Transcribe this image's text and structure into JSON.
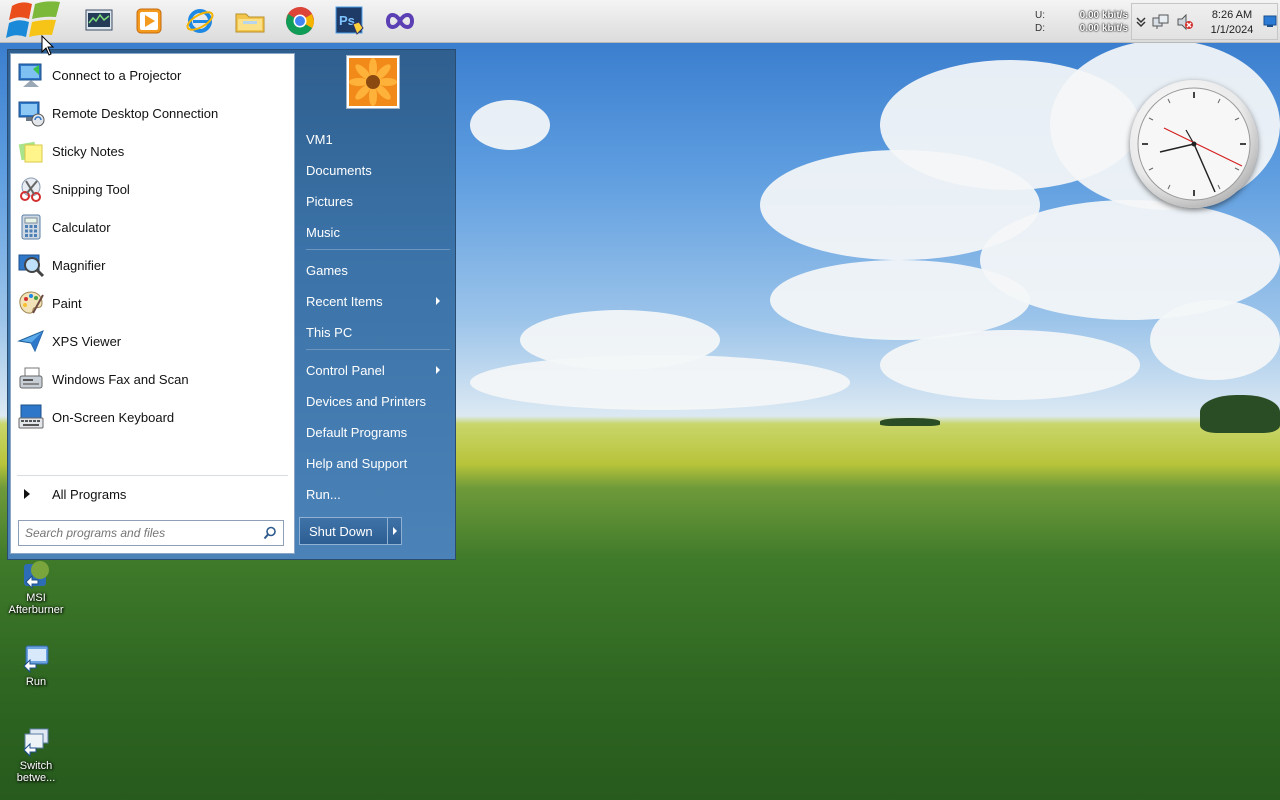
{
  "taskbar": {
    "start_button": "start-orb",
    "pinned": [
      {
        "name": "task-manager-icon"
      },
      {
        "name": "media-player-icon"
      },
      {
        "name": "internet-explorer-icon"
      },
      {
        "name": "file-explorer-icon"
      },
      {
        "name": "chrome-icon"
      },
      {
        "name": "photoshop-icon"
      },
      {
        "name": "visual-studio-icon"
      }
    ],
    "net_meter": {
      "up_label": "U:",
      "up_value": "0.00 kbit/s",
      "down_label": "D:",
      "down_value": "0.00 kbit/s"
    },
    "clock": {
      "time": "8:26 AM",
      "date": "1/1/2024"
    }
  },
  "start_menu": {
    "programs": [
      {
        "label": "Connect to a Projector",
        "icon": "projector-icon"
      },
      {
        "label": "Remote Desktop Connection",
        "icon": "remote-desktop-icon"
      },
      {
        "label": "Sticky Notes",
        "icon": "sticky-notes-icon"
      },
      {
        "label": "Snipping Tool",
        "icon": "scissors-icon"
      },
      {
        "label": "Calculator",
        "icon": "calculator-icon"
      },
      {
        "label": "Magnifier",
        "icon": "magnifier-icon"
      },
      {
        "label": "Paint",
        "icon": "palette-icon"
      },
      {
        "label": "XPS Viewer",
        "icon": "xps-viewer-icon"
      },
      {
        "label": "Windows Fax and Scan",
        "icon": "fax-icon"
      },
      {
        "label": "On-Screen Keyboard",
        "icon": "keyboard-icon"
      }
    ],
    "all_programs": "All Programs",
    "search_placeholder": "Search programs and files",
    "right_items": [
      {
        "label": "VM1",
        "submenu": false
      },
      {
        "label": "Documents",
        "submenu": false
      },
      {
        "label": "Pictures",
        "submenu": false
      },
      {
        "label": "Music",
        "submenu": false
      },
      {
        "label": "Games",
        "submenu": false
      },
      {
        "label": "Recent Items",
        "submenu": true
      },
      {
        "label": "This PC",
        "submenu": false
      },
      {
        "label": "Control Panel",
        "submenu": true
      },
      {
        "label": "Devices and Printers",
        "submenu": false
      },
      {
        "label": "Default Programs",
        "submenu": false
      },
      {
        "label": "Help and Support",
        "submenu": false
      },
      {
        "label": "Run...",
        "submenu": false
      }
    ],
    "shutdown_label": "Shut Down"
  },
  "desktop_icons": [
    {
      "label": "MSI Afterburner"
    },
    {
      "label": "Run"
    },
    {
      "label": "Switch betwe..."
    }
  ],
  "colors": {
    "menu_blue": "#3b73a8",
    "accent_orange": "#f28a1a"
  }
}
